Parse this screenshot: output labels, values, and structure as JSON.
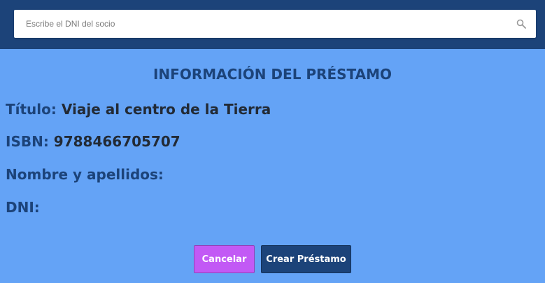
{
  "search": {
    "placeholder": "Escribe el DNI del socio"
  },
  "loan": {
    "heading": "INFORMACIÓN DEL PRÉSTAMO",
    "title_label": "Título:",
    "title_value": "Viaje al centro de la Tierra",
    "isbn_label": "ISBN:",
    "isbn_value": "9788466705707",
    "name_label": "Nombre y apellidos:",
    "name_value": "",
    "dni_label": "DNI:",
    "dni_value": ""
  },
  "actions": {
    "cancel_label": "Cancelar",
    "create_label": "Crear Préstamo"
  },
  "colors": {
    "header_bg": "#1c4379",
    "page_bg": "#64a3f6",
    "cancel_bg": "#c259f5",
    "create_bg": "#1c4379"
  },
  "icons": {
    "search": "search-icon"
  }
}
